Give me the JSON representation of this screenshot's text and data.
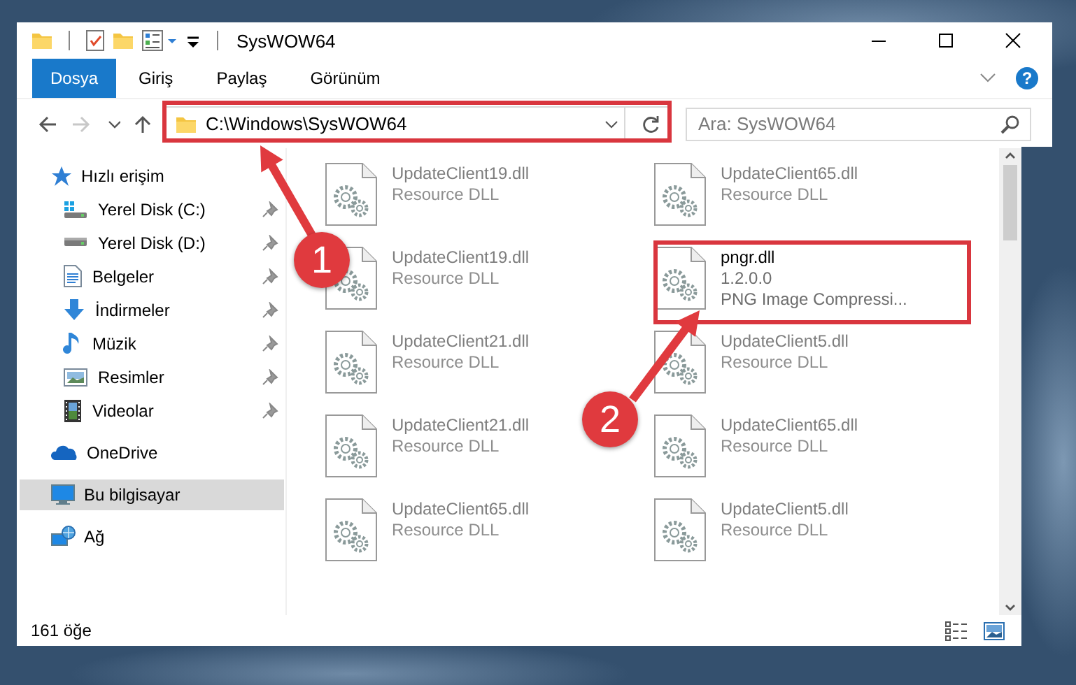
{
  "window": {
    "title": "SysWOW64"
  },
  "ribbon": {
    "tabs": [
      {
        "label": "Dosya",
        "kind": "file"
      },
      {
        "label": "Giriş",
        "kind": "tab"
      },
      {
        "label": "Paylaş",
        "kind": "tab"
      },
      {
        "label": "Görünüm",
        "kind": "tab"
      }
    ],
    "help": "?"
  },
  "navigation": [
    {
      "kind": "back",
      "disabled": false
    },
    {
      "kind": "forward",
      "disabled": true
    },
    {
      "kind": "recent",
      "disabled": false
    },
    {
      "kind": "up",
      "disabled": false
    }
  ],
  "address_bar": {
    "path": "C:\\Windows\\SysWOW64"
  },
  "search": {
    "placeholder": "Ara: SysWOW64"
  },
  "sidebar": {
    "items": [
      {
        "label": "Hızlı erişim",
        "kind": "star",
        "selected": false,
        "children": [
          {
            "label": "Yerel Disk (C:)",
            "kind": "system-drive",
            "pinned": true,
            "selected": false
          },
          {
            "label": "Yerel Disk (D:)",
            "kind": "drive",
            "pinned": true,
            "selected": false
          },
          {
            "label": "Belgeler",
            "kind": "document",
            "pinned": true,
            "selected": false
          },
          {
            "label": "İndirmeler",
            "kind": "download",
            "pinned": true,
            "selected": false
          },
          {
            "label": "Müzik",
            "kind": "music",
            "pinned": true,
            "selected": false
          },
          {
            "label": "Resimler",
            "kind": "image",
            "pinned": true,
            "selected": false
          },
          {
            "label": "Videolar",
            "kind": "video",
            "pinned": true,
            "selected": false
          }
        ]
      },
      {
        "label": "OneDrive",
        "kind": "cloud",
        "selected": false
      },
      {
        "label": "Bu bilgisayar",
        "kind": "computer",
        "selected": true
      },
      {
        "label": "Ağ",
        "kind": "network",
        "selected": false
      }
    ]
  },
  "files": [
    {
      "name": "UpdateClient19.dll",
      "details": [
        "Resource DLL"
      ],
      "blurred": true
    },
    {
      "name": "UpdateClient65.dll",
      "details": [
        "Resource DLL"
      ],
      "blurred": true
    },
    {
      "name": "UpdateClient19.dll",
      "details": [
        "Resource DLL"
      ],
      "blurred": true
    },
    {
      "name": "pngr.dll",
      "details": [
        "1.2.0.0",
        "PNG Image Compressi..."
      ],
      "blurred": false
    },
    {
      "name": "UpdateClient21.dll",
      "details": [
        "Resource DLL"
      ],
      "blurred": true
    },
    {
      "name": "UpdateClient5.dll",
      "details": [
        "Resource DLL"
      ],
      "blurred": true
    },
    {
      "name": "UpdateClient21.dll",
      "details": [
        "Resource DLL"
      ],
      "blurred": true
    },
    {
      "name": "UpdateClient65.dll",
      "details": [
        "Resource DLL"
      ],
      "blurred": true
    },
    {
      "name": "UpdateClient65.dll",
      "details": [
        "Resource DLL"
      ],
      "blurred": true
    },
    {
      "name": "UpdateClient5.dll",
      "details": [
        "Resource DLL"
      ],
      "blurred": true
    }
  ],
  "status_bar": {
    "count": "161 öğe"
  },
  "view_buttons": [
    {
      "kind": "details"
    },
    {
      "kind": "large-icons"
    }
  ],
  "annotations": [
    {
      "number": "1"
    },
    {
      "number": "2"
    }
  ]
}
